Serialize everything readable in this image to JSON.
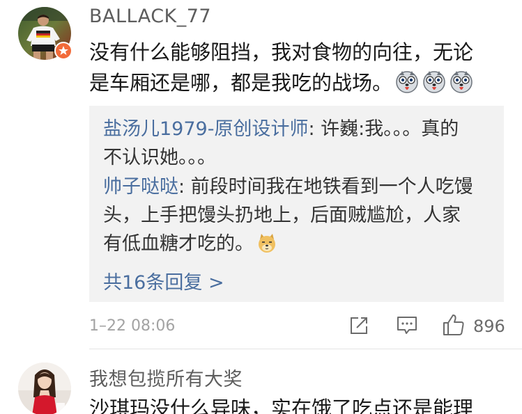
{
  "comments": [
    {
      "username": "BALLACK_77",
      "content_lines": [
        "没有什么能够阻挡，我对食物的向往，无论",
        "是车厢还是哪，都是我吃的战场。"
      ],
      "replies": [
        {
          "name": "盐汤儿1979-原创设计师",
          "text_first": ": 许巍:我。。。真的",
          "text_lines": [
            "不认识她。。。"
          ]
        },
        {
          "name": "帅子哒哒",
          "text_first": ": 前段时间我在地铁看到一个人吃馒",
          "text_lines": [
            "头，上手把馒头扔地上，后面贼尴尬，人家",
            "有低血糖才吃的。"
          ]
        }
      ],
      "more_replies": "共16条回复 >",
      "timestamp": "1–22 08:06",
      "like_count": "896",
      "icons": [
        "share-icon",
        "comment-icon",
        "like-icon",
        "verified-badge-icon",
        "husky-emoji",
        "doge-emoji"
      ]
    },
    {
      "username": "我想包揽所有大奖",
      "content_lines": [
        "沙琪玛没什么异味，实在饿了吃点还是能理"
      ]
    }
  ],
  "colors": {
    "username": "#5d5d5d",
    "reply_name": "#4a6e9f",
    "reply_bg": "#f2f2f2",
    "timestamp": "#a3a3a3",
    "badge": "#f26b3a"
  }
}
